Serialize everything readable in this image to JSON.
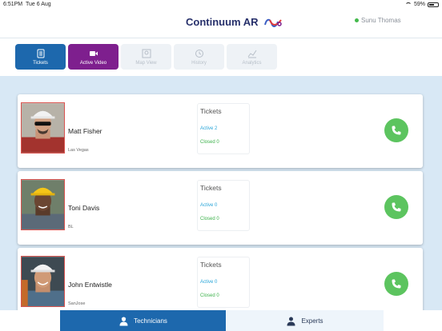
{
  "status_bar": {
    "time": "6:51PM",
    "date": "Tue 6 Aug",
    "battery": "59%"
  },
  "header": {
    "title": "Continuum AR",
    "user_name": "Sunu Thomas"
  },
  "toolbar": {
    "tickets": "Tickets",
    "active_video": "Active Video",
    "map_view": "Map View",
    "history": "History",
    "analytics": "Analytics"
  },
  "technicians": [
    {
      "name": "Matt Fisher",
      "location": "Las Vegas",
      "tickets_label": "Tickets",
      "active": "Active 2",
      "closed": "Closed 0"
    },
    {
      "name": "Toni Davis",
      "location": "BL",
      "tickets_label": "Tickets",
      "active": "Active 0",
      "closed": "Closed 0"
    },
    {
      "name": "John Entwistle",
      "location": "SanJose",
      "tickets_label": "Tickets",
      "active": "Active 0",
      "closed": "Closed 0"
    }
  ],
  "bottom_tabs": {
    "technicians": "Technicians",
    "experts": "Experts"
  },
  "colors": {
    "primary": "#1d68ad",
    "video": "#7e1f8e",
    "call": "#5cc45f",
    "list_bg": "#d8e8f5"
  }
}
